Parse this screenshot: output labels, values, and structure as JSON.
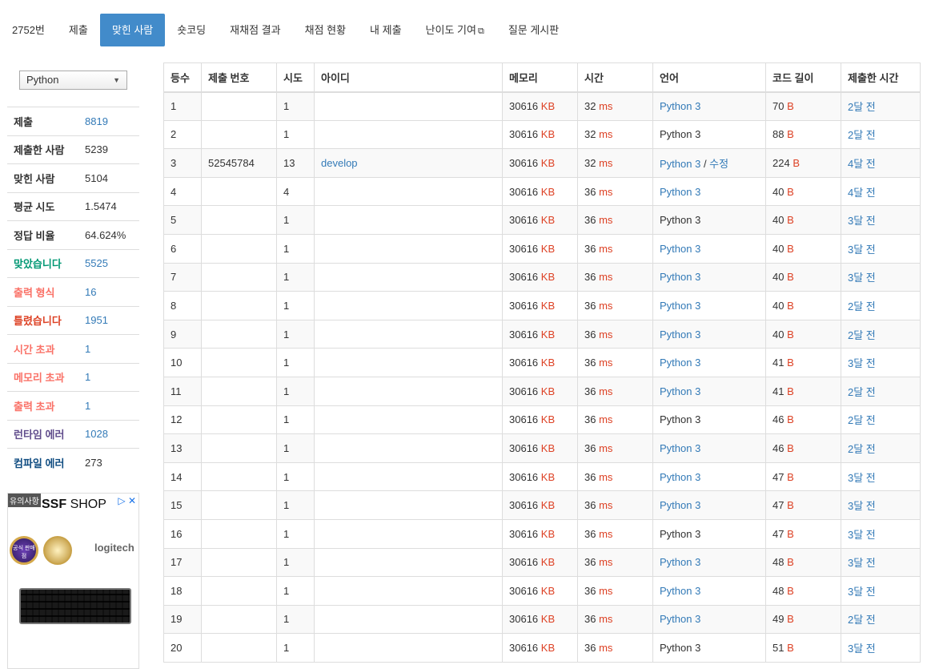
{
  "nav": {
    "tabs": [
      {
        "label": "2752번",
        "active": false
      },
      {
        "label": "제출",
        "active": false
      },
      {
        "label": "맞힌 사람",
        "active": true
      },
      {
        "label": "숏코딩",
        "active": false
      },
      {
        "label": "재채점 결과",
        "active": false
      },
      {
        "label": "채점 현황",
        "active": false
      },
      {
        "label": "내 제출",
        "active": false
      },
      {
        "label": "난이도 기여",
        "active": false,
        "external": true
      },
      {
        "label": "질문 게시판",
        "active": false
      }
    ],
    "external_icon": "external-link-icon"
  },
  "sidebar": {
    "language_select": "Python",
    "stats": [
      {
        "label": "제출",
        "value": "8819",
        "link": true,
        "color": ""
      },
      {
        "label": "제출한 사람",
        "value": "5239",
        "link": false,
        "color": ""
      },
      {
        "label": "맞힌 사람",
        "value": "5104",
        "link": false,
        "color": ""
      },
      {
        "label": "평균 시도",
        "value": "1.5474",
        "link": false,
        "color": ""
      },
      {
        "label": "정답 비율",
        "value": "64.624%",
        "link": false,
        "color": ""
      },
      {
        "label": "맞았습니다",
        "value": "5525",
        "link": true,
        "color": "green"
      },
      {
        "label": "출력 형식",
        "value": "16",
        "link": true,
        "color": "orange"
      },
      {
        "label": "틀렸습니다",
        "value": "1951",
        "link": true,
        "color": "red"
      },
      {
        "label": "시간 초과",
        "value": "1",
        "link": true,
        "color": "orange"
      },
      {
        "label": "메모리 초과",
        "value": "1",
        "link": true,
        "color": "orange"
      },
      {
        "label": "출력 초과",
        "value": "1",
        "link": true,
        "color": "orange"
      },
      {
        "label": "런타임 에러",
        "value": "1028",
        "link": true,
        "color": "purple"
      },
      {
        "label": "컴파일 에러",
        "value": "273",
        "link": false,
        "color": "navy"
      }
    ]
  },
  "ad": {
    "label": "유의사항",
    "brand_bold": "SSF",
    "brand_rest": " SHOP",
    "logo": "logitech",
    "badge_text": "공식 판매점"
  },
  "table": {
    "headers": [
      "등수",
      "제출 번호",
      "시도",
      "아이디",
      "메모리",
      "시간",
      "언어",
      "코드 길이",
      "제출한 시간"
    ],
    "rows": [
      {
        "rank": "1",
        "id": "",
        "tries": "1",
        "user": "",
        "mem": "30616",
        "time": "32",
        "lang": "Python 3",
        "lang_link": true,
        "edit": "",
        "len": "70",
        "ago": "2달 전"
      },
      {
        "rank": "2",
        "id": "",
        "tries": "1",
        "user": "",
        "mem": "30616",
        "time": "32",
        "lang": "Python 3",
        "lang_link": false,
        "edit": "",
        "len": "88",
        "ago": "2달 전"
      },
      {
        "rank": "3",
        "id": "52545784",
        "tries": "13",
        "user": "develop",
        "mem": "30616",
        "time": "32",
        "lang": "Python 3",
        "lang_link": true,
        "edit": "수정",
        "len": "224",
        "ago": "4달 전"
      },
      {
        "rank": "4",
        "id": "",
        "tries": "4",
        "user": "",
        "mem": "30616",
        "time": "36",
        "lang": "Python 3",
        "lang_link": true,
        "edit": "",
        "len": "40",
        "ago": "4달 전"
      },
      {
        "rank": "5",
        "id": "",
        "tries": "1",
        "user": "",
        "mem": "30616",
        "time": "36",
        "lang": "Python 3",
        "lang_link": false,
        "edit": "",
        "len": "40",
        "ago": "3달 전"
      },
      {
        "rank": "6",
        "id": "",
        "tries": "1",
        "user": "",
        "mem": "30616",
        "time": "36",
        "lang": "Python 3",
        "lang_link": true,
        "edit": "",
        "len": "40",
        "ago": "3달 전"
      },
      {
        "rank": "7",
        "id": "",
        "tries": "1",
        "user": "",
        "mem": "30616",
        "time": "36",
        "lang": "Python 3",
        "lang_link": true,
        "edit": "",
        "len": "40",
        "ago": "3달 전"
      },
      {
        "rank": "8",
        "id": "",
        "tries": "1",
        "user": "",
        "mem": "30616",
        "time": "36",
        "lang": "Python 3",
        "lang_link": true,
        "edit": "",
        "len": "40",
        "ago": "2달 전"
      },
      {
        "rank": "9",
        "id": "",
        "tries": "1",
        "user": "",
        "mem": "30616",
        "time": "36",
        "lang": "Python 3",
        "lang_link": true,
        "edit": "",
        "len": "40",
        "ago": "2달 전"
      },
      {
        "rank": "10",
        "id": "",
        "tries": "1",
        "user": "",
        "mem": "30616",
        "time": "36",
        "lang": "Python 3",
        "lang_link": true,
        "edit": "",
        "len": "41",
        "ago": "3달 전"
      },
      {
        "rank": "11",
        "id": "",
        "tries": "1",
        "user": "",
        "mem": "30616",
        "time": "36",
        "lang": "Python 3",
        "lang_link": true,
        "edit": "",
        "len": "41",
        "ago": "2달 전"
      },
      {
        "rank": "12",
        "id": "",
        "tries": "1",
        "user": "",
        "mem": "30616",
        "time": "36",
        "lang": "Python 3",
        "lang_link": false,
        "edit": "",
        "len": "46",
        "ago": "2달 전"
      },
      {
        "rank": "13",
        "id": "",
        "tries": "1",
        "user": "",
        "mem": "30616",
        "time": "36",
        "lang": "Python 3",
        "lang_link": true,
        "edit": "",
        "len": "46",
        "ago": "2달 전"
      },
      {
        "rank": "14",
        "id": "",
        "tries": "1",
        "user": "",
        "mem": "30616",
        "time": "36",
        "lang": "Python 3",
        "lang_link": true,
        "edit": "",
        "len": "47",
        "ago": "3달 전"
      },
      {
        "rank": "15",
        "id": "",
        "tries": "1",
        "user": "",
        "mem": "30616",
        "time": "36",
        "lang": "Python 3",
        "lang_link": true,
        "edit": "",
        "len": "47",
        "ago": "3달 전"
      },
      {
        "rank": "16",
        "id": "",
        "tries": "1",
        "user": "",
        "mem": "30616",
        "time": "36",
        "lang": "Python 3",
        "lang_link": false,
        "edit": "",
        "len": "47",
        "ago": "3달 전"
      },
      {
        "rank": "17",
        "id": "",
        "tries": "1",
        "user": "",
        "mem": "30616",
        "time": "36",
        "lang": "Python 3",
        "lang_link": true,
        "edit": "",
        "len": "48",
        "ago": "3달 전"
      },
      {
        "rank": "18",
        "id": "",
        "tries": "1",
        "user": "",
        "mem": "30616",
        "time": "36",
        "lang": "Python 3",
        "lang_link": true,
        "edit": "",
        "len": "48",
        "ago": "3달 전"
      },
      {
        "rank": "19",
        "id": "",
        "tries": "1",
        "user": "",
        "mem": "30616",
        "time": "36",
        "lang": "Python 3",
        "lang_link": true,
        "edit": "",
        "len": "49",
        "ago": "2달 전"
      },
      {
        "rank": "20",
        "id": "",
        "tries": "1",
        "user": "",
        "mem": "30616",
        "time": "36",
        "lang": "Python 3",
        "lang_link": false,
        "edit": "",
        "len": "51",
        "ago": "3달 전"
      }
    ],
    "units": {
      "mem": "KB",
      "time": "ms",
      "len": "B"
    },
    "edit_sep": " / "
  },
  "colors": {
    "accent": "#428bca",
    "link": "#337ab7",
    "unit": "#dd4124",
    "green": "#009874",
    "orange": "#fa7268",
    "red": "#dd4124",
    "purple": "#5f4b8b",
    "navy": "#0f4c81"
  }
}
